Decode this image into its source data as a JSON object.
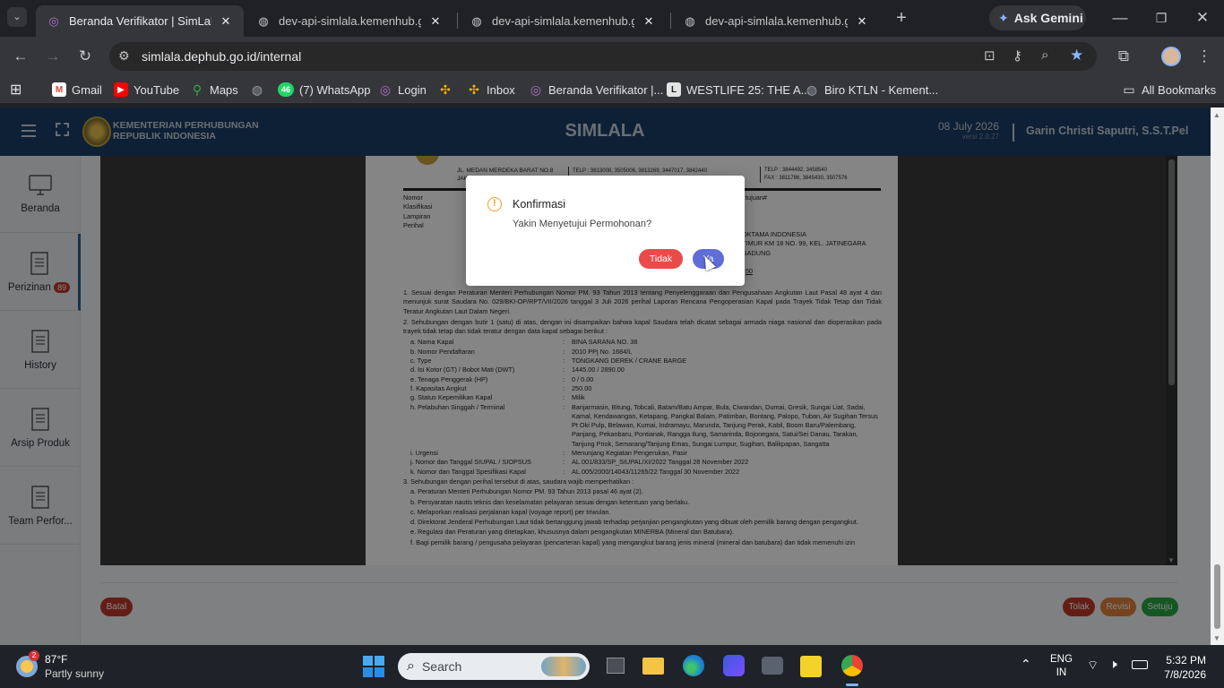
{
  "browser": {
    "tabs": [
      {
        "title": "Beranda Verifikator | SimLala",
        "active": true
      },
      {
        "title": "dev-api-simlala.kemenhub.go.id/..."
      },
      {
        "title": "dev-api-simlala.kemenhub.go.id/..."
      },
      {
        "title": "dev-api-simlala.kemenhub.go.id/..."
      }
    ],
    "gemini_label": "Ask Gemini",
    "url": "simlala.dephub.go.id/internal",
    "bookmarks": [
      {
        "label": "Gmail",
        "icon": "gmail-icon",
        "color": "#ea4335"
      },
      {
        "label": "YouTube",
        "icon": "youtube-icon",
        "color": "#ff0000"
      },
      {
        "label": "Maps",
        "icon": "maps-icon",
        "color": "#34a853"
      },
      {
        "label": "",
        "icon": "globe-icon",
        "color": "#9aa0a6"
      },
      {
        "label": "(7) WhatsApp",
        "icon": "whatsapp-icon",
        "color": "#25d366",
        "badge": "46"
      },
      {
        "label": "Login",
        "icon": "login-icon",
        "color": "#b06fc9"
      },
      {
        "label": "",
        "icon": "pinwheel-icon",
        "color": "#f4b400"
      },
      {
        "label": "Inbox",
        "icon": "inbox-icon",
        "color": "#f4b400"
      },
      {
        "label": "Beranda Verifikator |...",
        "icon": "simlala-icon",
        "color": "#b06fc9"
      },
      {
        "label": "WESTLIFE 25: THE A...",
        "icon": "ticket-icon",
        "color": "#e3e3e3"
      },
      {
        "label": "Biro KTLN - Kement...",
        "icon": "globe-icon",
        "color": "#9aa0a6"
      }
    ],
    "all_bookmarks": "All Bookmarks"
  },
  "app": {
    "ministry_line1": "KEMENTERIAN PERHUBUNGAN",
    "ministry_line2": "REPUBLIK INDONESIA",
    "title": "SIMLALA",
    "date": "08 July 2026",
    "version": "versi 2.0.27",
    "user": "Garin Christi Saputri, S.S.T.Pel",
    "nav": [
      {
        "label": "Beranda",
        "icon": "monitor-icon"
      },
      {
        "label": "Perizinan",
        "icon": "document-icon",
        "badge": "89"
      },
      {
        "label": "History",
        "icon": "document-icon"
      },
      {
        "label": "Arsip Produk",
        "icon": "document-icon"
      },
      {
        "label": "Team Perfor...",
        "icon": "document-icon"
      }
    ],
    "buttons": {
      "batal": "Batal",
      "tolak": "Tolak",
      "revisi": "Revisi",
      "setuju": "Setuju"
    }
  },
  "document": {
    "address_left": "JL. MEDAN MERDEKA BARAT NO.8",
    "address_left2": "JAK",
    "telp_mid": "TELP : 3813008, 3505006, 3813269, 3447017, 3842440",
    "telp_right": "TELP : 3844492, 3458540",
    "fax_right": "FAX : 3811786, 3845430, 3507576",
    "meta_labels": [
      "Nomor",
      "Klasifikasi",
      "Lampiran",
      "Perihal"
    ],
    "right_top": "tujuan#",
    "recipient": [
      "OKTAMA INDONESIA",
      "TIMUR KM 18 NO. 99, KEL. JATINEGARA",
      "GADUNG"
    ],
    "rec_num": "50",
    "para1": "1. Sesuai dengan Peraturan Menteri Perhubungan Nomor PM. 93 Tahun 2013 tentang Penyelenggaraan dan Pengusahaan Angkutan Laut Pasal 48 ayat 4 dan menunjuk surat Saudara No. 029/BKI-OP/RPT/VII/2026 tanggal 3 Juli 2026 perihal Laporan Rencana Pengoperasian Kapal pada Trayek Tidak Tetap dan Tidak Teratur Angkutan Laut Dalam Negeri.",
    "para2": "2. Sehubungan dengan butir 1 (satu) di atas, dengan ini disampaikan bahwa kapal Saudara telah dicatat sebagai armada niaga nasional dan dioperasikan pada trayek tidak tetap dan tidak teratur dengan data kapal sebagai berikut :",
    "ship": [
      {
        "k": "a. Nama Kapal",
        "v": "BINA SARANA NO. 38"
      },
      {
        "k": "b. Nomor Pendaftaran",
        "v": "2010 PPj No. 1684/L"
      },
      {
        "k": "c. Type",
        "v": "TONGKANG DEREK / CRANE BARGE"
      },
      {
        "k": "d. Isi Kotor (GT) / Bobot Mati (DWT)",
        "v": "1445.00  / 2890.00"
      },
      {
        "k": "e. Tenaga Penggerak (HP)",
        "v": "0  / 0.00"
      },
      {
        "k": "f.  Kapasitas Angkut",
        "v": "250.00"
      },
      {
        "k": "g. Status Kepemilikan Kapal",
        "v": "Milik"
      },
      {
        "k": "h. Pelabuhan Singgah / Terminal",
        "v": "Banjarmasin, Bitung, Tobcali, Batam/Batu Ampar, Bula, Ciwandan, Dumai, Gresik, Sungai Liat, Sadai, Kamal, Kendawangan, Ketapang, Pangkal Balam, Patimban, Bontang, Palopo, Tuban, Air Sugihan Tersus Pt Oki Pulp, Belawan, Kumai, Indramayu, Marunda, Tanjung Perak, Kabil, Boom Baru/Palembang, Panjang, Pekanbaru, Pontianak, Rangga Ilung, Samarinda, Bojonegara, Satui/Sei Danau, Tarakan, Tanjung Priok, Semarang/Tanjung Emas, Sungai Lumpur, Sugihan, Balikpapan, Sangatta"
      },
      {
        "k": "i.  Urgensi",
        "v": "Menunjang Kegiatan Pengerukan, Pasir"
      },
      {
        "k": "j.  Nomor dan Tanggal SIUPAL / SIOPSUS",
        "v": "AL.001/833/SP_SIUPAL/XI/2022  Tanggal 28 November 2022"
      },
      {
        "k": "k. Nomor dan Tanggal Spesifikasi Kapal",
        "v": "AL.005/2000/14043/11265/22  Tanggal 30 November 2022"
      }
    ],
    "para3": "3. Sehubungan dengan perihal tersebut di atas, saudara wajib memperhatikan :",
    "obligations": [
      "a. Peraturan Menteri Perhubungan Nomor PM. 93 Tahun 2013 pasal 46 ayat (2).",
      "b. Persyaratan nautis teknis dan keselamatan pelayaran sesuai dengan ketentuan yang berlaku.",
      "c. Melaporkan realisasi perjalanan kapal (voyage report) per triwulan.",
      "d. Direktorat Jenderal Perhubungan Laut tidak bertanggung jawab terhadap perjanjian pengangkutan yang dibuat oleh pemilik barang dengan pengangkut.",
      "e. Regulasi dan Peraturan yang ditetapkan, khususnya dalam pengangkutan MINERBA (Mineral dan Batubara).",
      "f. Bagi pemilik barang / pengusaha pelayaran (pencarteran kapal) yang mengangkut barang jenis mineral (mineral dan batubara) dan tidak memenuhi izin"
    ]
  },
  "modal": {
    "title": "Konfirmasi",
    "message": "Yakin Menyetujui Permohonan?",
    "no": "Tidak",
    "yes": "Ya"
  },
  "taskbar": {
    "weather_badge": "2",
    "temp": "87°F",
    "weather": "Partly sunny",
    "search": "Search",
    "lang1": "ENG",
    "lang2": "IN",
    "time": "5:32 PM",
    "date": "7/8/2026"
  }
}
